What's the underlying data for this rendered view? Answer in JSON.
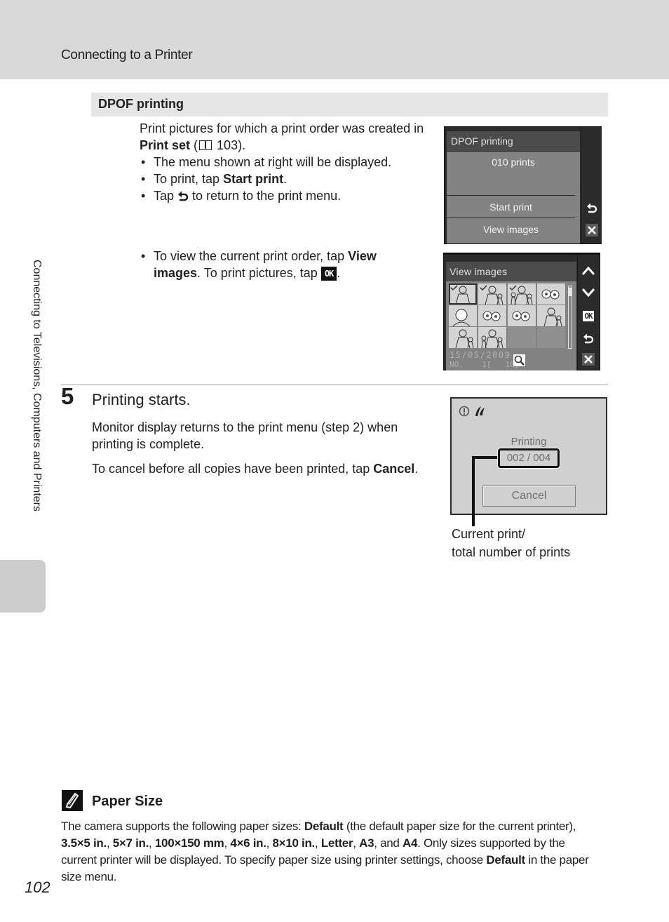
{
  "header": {
    "title": "Connecting to a Printer"
  },
  "side_tab": {
    "label": "Connecting to Televisions, Computers and Printers"
  },
  "section": {
    "title": "DPOF printing",
    "intro_pre": "Print pictures for which a print order was created in ",
    "intro_bold": "Print set",
    "intro_ref": "103",
    "intro_post": ").",
    "bullets": [
      {
        "text": "The menu shown at right will be displayed."
      },
      {
        "pre": "To print, tap ",
        "bold": "Start print",
        "post": "."
      },
      {
        "pre": "Tap ",
        "icon": "back-icon",
        "post": " to return to the print menu."
      }
    ],
    "bullet_view": {
      "pre": "To view the current print order, tap ",
      "bold": "View images",
      "mid": ". To print pictures, tap ",
      "icon_label": "OK",
      "post": "."
    }
  },
  "screen_dpof": {
    "title": "DPOF printing",
    "count": "010 prints",
    "items": [
      "Start print",
      "View images"
    ],
    "side_icons": [
      "back-icon",
      "close-icon"
    ]
  },
  "screen_view_images": {
    "title": "View images",
    "thumbnails": [
      {
        "subject": "woman-checked",
        "selected": true
      },
      {
        "subject": "woman-child-checked"
      },
      {
        "subject": "family-checked"
      },
      {
        "subject": "flowers"
      },
      {
        "subject": "woman-portrait"
      },
      {
        "subject": "flowers"
      },
      {
        "subject": "flowers"
      },
      {
        "subject": "woman-child"
      },
      {
        "subject": "woman-child"
      },
      {
        "subject": "family"
      },
      {
        "subject": "empty"
      },
      {
        "subject": "empty"
      }
    ],
    "date": "15/05/2009",
    "number_readout": "NO.    1[   10]",
    "side_icons": [
      "up-arrow-icon",
      "down-arrow-icon",
      "ok-icon",
      "back-icon",
      "close-icon"
    ],
    "ok_label": "OK"
  },
  "step5": {
    "number": "5",
    "title": "Printing starts.",
    "p1": "Monitor display returns to the print menu (step 2) when printing is complete.",
    "p2_pre": "To cancel before all copies have been printed, tap ",
    "p2_bold": "Cancel",
    "p2_post": "."
  },
  "screen_printing": {
    "status": "Printing",
    "counter": "002  /  004",
    "current": 2,
    "total": 4,
    "cancel_label": "Cancel",
    "callout": [
      "Current print/",
      "total number of prints"
    ]
  },
  "note": {
    "title": "Paper Size",
    "segments": [
      {
        "t": "The camera supports the following paper sizes: "
      },
      {
        "t": "Default",
        "b": true
      },
      {
        "t": " (the default paper size for the current printer), "
      },
      {
        "t": "3.5×5 in.",
        "b": true
      },
      {
        "t": ", "
      },
      {
        "t": "5×7 in.",
        "b": true
      },
      {
        "t": ", "
      },
      {
        "t": "100×150 mm",
        "b": true
      },
      {
        "t": ", "
      },
      {
        "t": "4×6 in.",
        "b": true
      },
      {
        "t": ", "
      },
      {
        "t": "8×10 in.",
        "b": true
      },
      {
        "t": ", "
      },
      {
        "t": "Letter",
        "b": true
      },
      {
        "t": ", "
      },
      {
        "t": "A3",
        "b": true
      },
      {
        "t": ", and "
      },
      {
        "t": "A4",
        "b": true
      },
      {
        "t": ". Only sizes supported by the current printer will be displayed. To specify paper size using printer settings, choose "
      },
      {
        "t": "Default",
        "b": true
      },
      {
        "t": " in the paper size menu."
      }
    ]
  },
  "page_number": "102"
}
